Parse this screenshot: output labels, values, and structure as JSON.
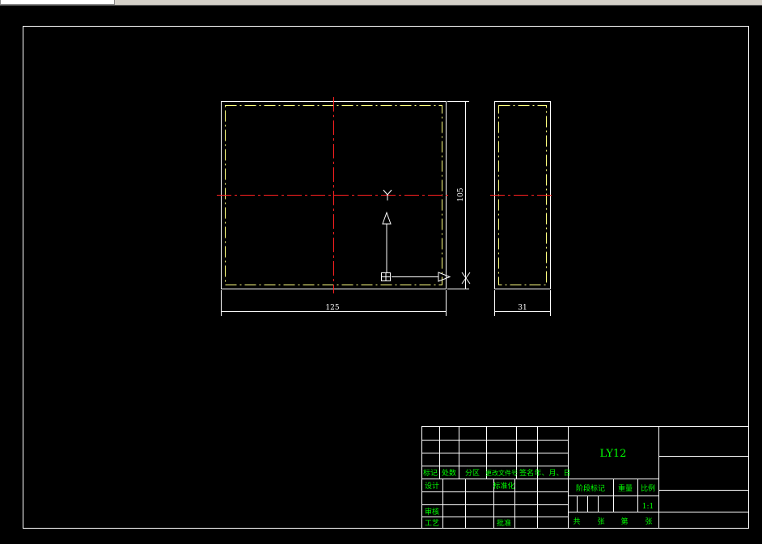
{
  "drawing": {
    "dim_width": "125",
    "dim_height": "105",
    "dim_thickness": "31",
    "ucs_x": "X",
    "ucs_y": "Y"
  },
  "title_block": {
    "material": "LY12",
    "header_labels": [
      "标记",
      "处数",
      "分区",
      "更改文件号",
      "签名",
      "年、月、日"
    ],
    "design": "设计",
    "standardization": "标准化",
    "review": "审核",
    "process": "工艺",
    "approve": "批准",
    "stage_mark": "阶段标记",
    "weight": "重量",
    "scale_label": "比例",
    "scale_value": "1:1",
    "total": "共",
    "sheets": "张",
    "nth": "第",
    "sheet": "张"
  },
  "colors": {
    "border": "#ffffff",
    "outline": "#ffffff",
    "hidden": "#ffff80",
    "center": "#ff2020",
    "text": "#00ff00"
  }
}
